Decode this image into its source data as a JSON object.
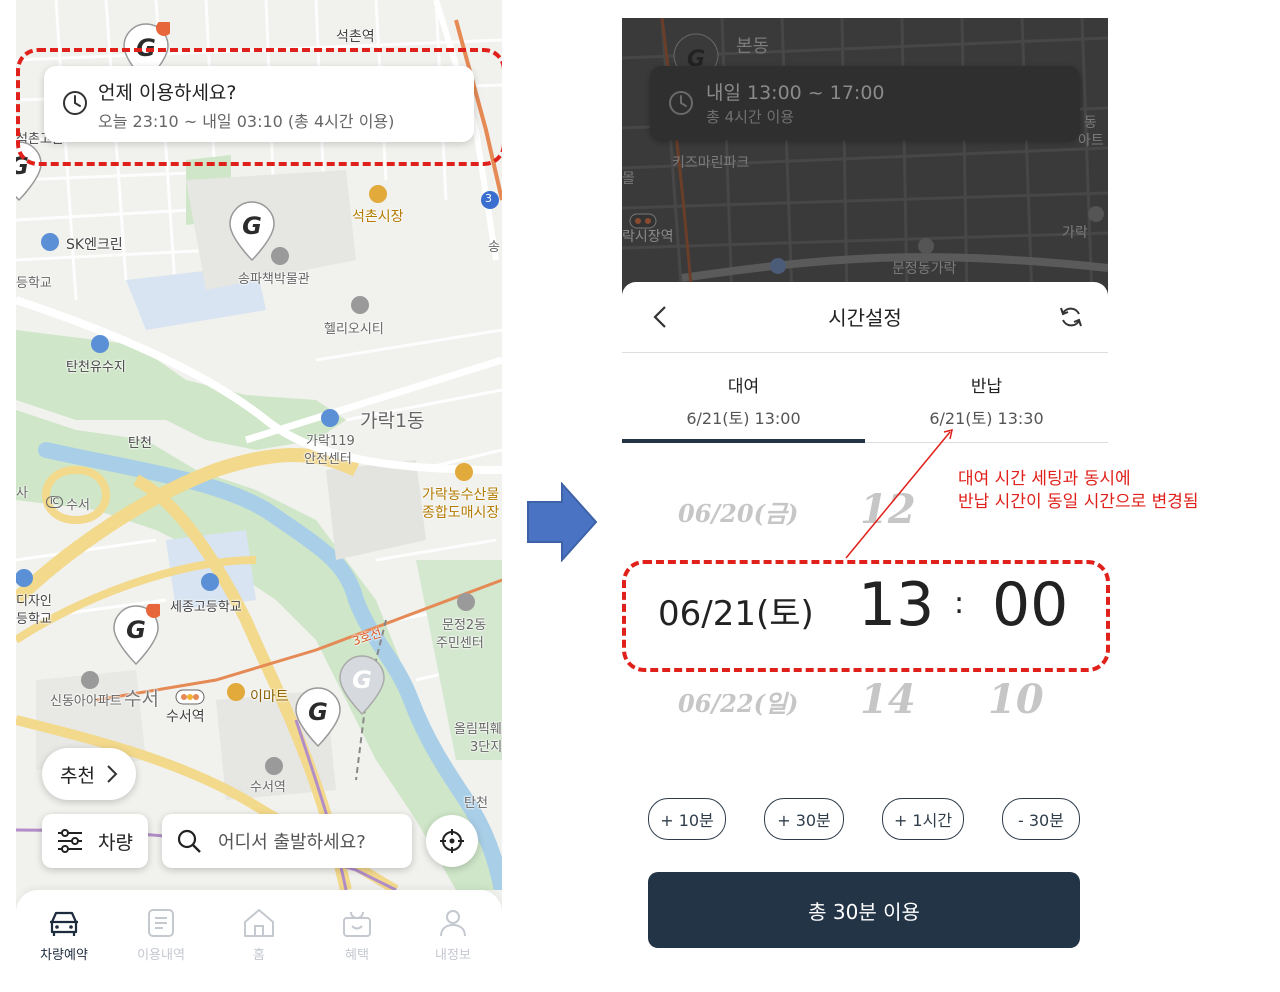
{
  "left": {
    "map_labels": {
      "seokchon_station": "석촌역",
      "seokchon_market": "석촌시장",
      "sk_enclean": "SK엔크린",
      "school_left": "등학교",
      "songpa_museum": "송파책박물관",
      "helio_city": "헬리오시티",
      "tancheon_reservoir": "탄천유수지",
      "garak1dong": "가락1동",
      "garak119_line1": "가락119",
      "garak119_line2": "안전센터",
      "tancheon": "탄천",
      "ic_label": "IC",
      "suseo_ic": "수서",
      "garak_market_line1": "가락농수산물",
      "garak_market_line2": "종합도매시장",
      "design_line1": "디자인",
      "design_line2": "등학교",
      "sejong_high": "세종고등학교",
      "munjeong2_line1": "문정2동",
      "munjeong2_line2": "주민센터",
      "line3": "3호선",
      "sindong_apt": "신동아아파트",
      "suseo_big": "수서",
      "suseo_station": "수서역",
      "emart": "이마트",
      "suseo_station2": "수서역",
      "olympic_line1": "올림픽훼",
      "olympic_line2": "3단지",
      "tancheon2": "탄천",
      "song_right": "송",
      "sa_left": "사",
      "route_3": "3",
      "seokchon_left": "석촌고분"
    },
    "when_card": {
      "title": "언제 이용하세요?",
      "subtitle": "오늘 23:10 ~ 내일 03:10 (총 4시간 이용)"
    },
    "recommend_label": "추천",
    "vehicle_button": "차량",
    "search_placeholder": "어디서 출발하세요?",
    "nav": [
      {
        "label": "차량예약",
        "icon": "car-icon"
      },
      {
        "label": "이용내역",
        "icon": "list-icon"
      },
      {
        "label": "홈",
        "icon": "home-icon"
      },
      {
        "label": "혜택",
        "icon": "gift-icon"
      },
      {
        "label": "내정보",
        "icon": "person-icon"
      }
    ]
  },
  "right": {
    "dark_labels": {
      "bondong": "본동",
      "kids_marine": "키즈마린파크",
      "garak_market_station": "락시장역",
      "munjeong_garak": "문정동가락",
      "dong_right": "동",
      "apt_right": "아트",
      "garak_right": "가락",
      "mol": "몰"
    },
    "card": {
      "title": "내일 13:00 ~ 17:00",
      "subtitle": "총 4시간 이용"
    },
    "sheet_title": "시간설정",
    "tabs": [
      {
        "label": "대여",
        "value": "6/21(토) 13:00"
      },
      {
        "label": "반납",
        "value": "6/21(토) 13:30"
      }
    ],
    "picker": {
      "prev_date": "06/20(금)",
      "prev_hour": "12",
      "sel_date": "06/21(토)",
      "sel_hour": "13",
      "separator": ":",
      "sel_minute": "00",
      "next_date": "06/22(일)",
      "next_hour": "14",
      "next_minute": "10"
    },
    "chips": [
      "+ 10분",
      "+ 30분",
      "+ 1시간",
      "- 30분"
    ],
    "primary_button": "총 30분 이용"
  },
  "annotation": {
    "line1": "대여 시간 세팅과 동시에",
    "line2": "반납 시간이 동일 시간으로 변경됨"
  },
  "colors": {
    "highlight_red": "#e0201a",
    "navy": "#243447",
    "arrow_blue": "#4a73c4"
  }
}
